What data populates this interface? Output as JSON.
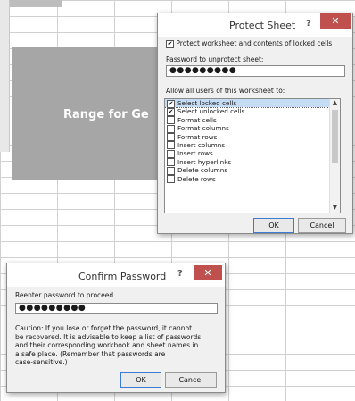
{
  "worksheet": {
    "range_label": "Range for Ge"
  },
  "protect_sheet": {
    "title": "Protect Sheet",
    "help": "?",
    "close": "✕",
    "protect_checkbox_label": "Protect worksheet and contents of locked cells",
    "protect_checked": true,
    "password_label": "Password to unprotect sheet:",
    "password_value": "●●●●●●●●●",
    "allow_label": "Allow all users of this worksheet to:",
    "permissions": [
      {
        "label": "Select locked cells",
        "checked": true,
        "selected": true
      },
      {
        "label": "Select unlocked cells",
        "checked": true
      },
      {
        "label": "Format cells",
        "checked": false
      },
      {
        "label": "Format columns",
        "checked": false
      },
      {
        "label": "Format rows",
        "checked": false
      },
      {
        "label": "Insert columns",
        "checked": false
      },
      {
        "label": "Insert rows",
        "checked": false
      },
      {
        "label": "Insert hyperlinks",
        "checked": false
      },
      {
        "label": "Delete columns",
        "checked": false
      },
      {
        "label": "Delete rows",
        "checked": false
      }
    ],
    "ok_label": "OK",
    "cancel_label": "Cancel"
  },
  "confirm_password": {
    "title": "Confirm Password",
    "help": "?",
    "close": "✕",
    "reenter_label": "Reenter password to proceed.",
    "password_value": "●●●●●●●●●",
    "caution_lines": [
      "Caution: If you lose or forget the password, it cannot",
      "be recovered. It is advisable to keep a list of passwords",
      "and their corresponding workbook and sheet names in",
      "a safe place.  (Remember that passwords are",
      "case-sensitive.)"
    ],
    "ok_label": "OK",
    "cancel_label": "Cancel"
  }
}
